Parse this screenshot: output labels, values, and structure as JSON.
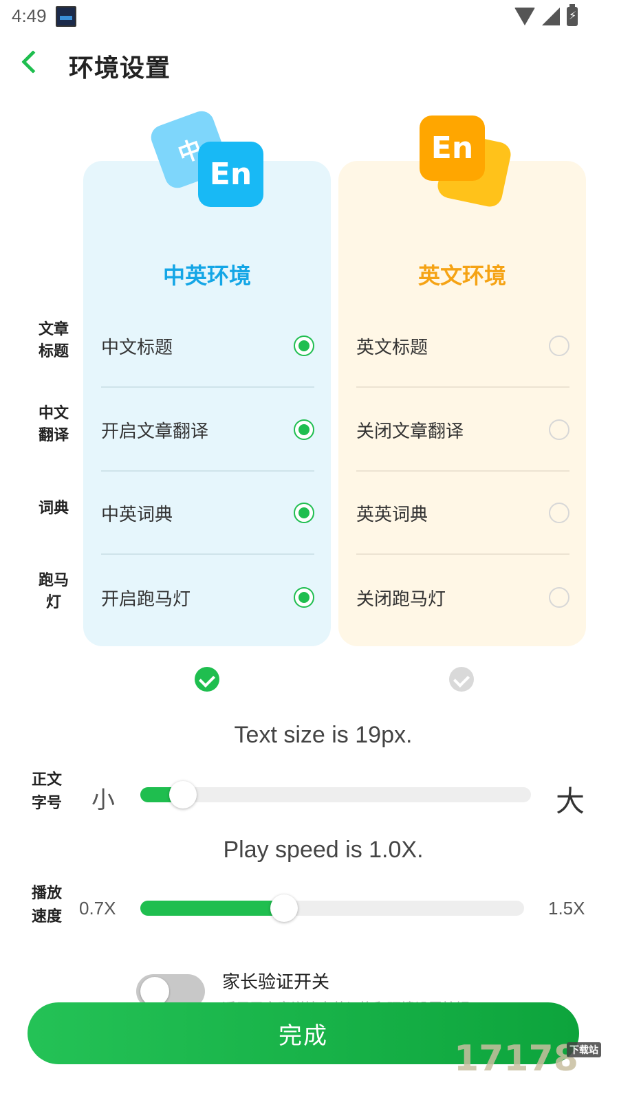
{
  "status": {
    "time": "4:49",
    "battery_glyph": "⚡"
  },
  "header": {
    "title": "环境设置"
  },
  "badges": {
    "cn_back": "中",
    "cn_front": "En",
    "en_back": "",
    "en_front": "En"
  },
  "cards": {
    "cn": {
      "title": "中英环境",
      "options": [
        "中文标题",
        "开启文章翻译",
        "中英词典",
        "开启跑马灯"
      ]
    },
    "en": {
      "title": "英文环境",
      "options": [
        "英文标题",
        "关闭文章翻译",
        "英英词典",
        "关闭跑马灯"
      ]
    }
  },
  "row_labels": [
    "文章\n标题",
    "中文\n翻译",
    "词典",
    "跑马\n灯"
  ],
  "selected_environment": "中英环境",
  "text_size": {
    "caption": "Text size is 19px.",
    "label": "正文\n字号",
    "min_label": "小",
    "max_label": "大",
    "level": 0.11
  },
  "play_speed": {
    "caption": "Play speed is 1.0X.",
    "label": "播放\n速度",
    "min_label": "0.7X",
    "max_label": "1.5X",
    "value": 1.0
  },
  "parent_switch": {
    "title": "家长验证开关",
    "description": "适用于文章详情中英切换和环境设置按钮",
    "enabled": false
  },
  "done_button": "完成",
  "watermark": {
    "text": "17178",
    "tag": "下载站"
  },
  "colors": {
    "accent": "#1fbe4f",
    "cn_blue": "#14a6e6",
    "en_orange": "#f5a315"
  }
}
